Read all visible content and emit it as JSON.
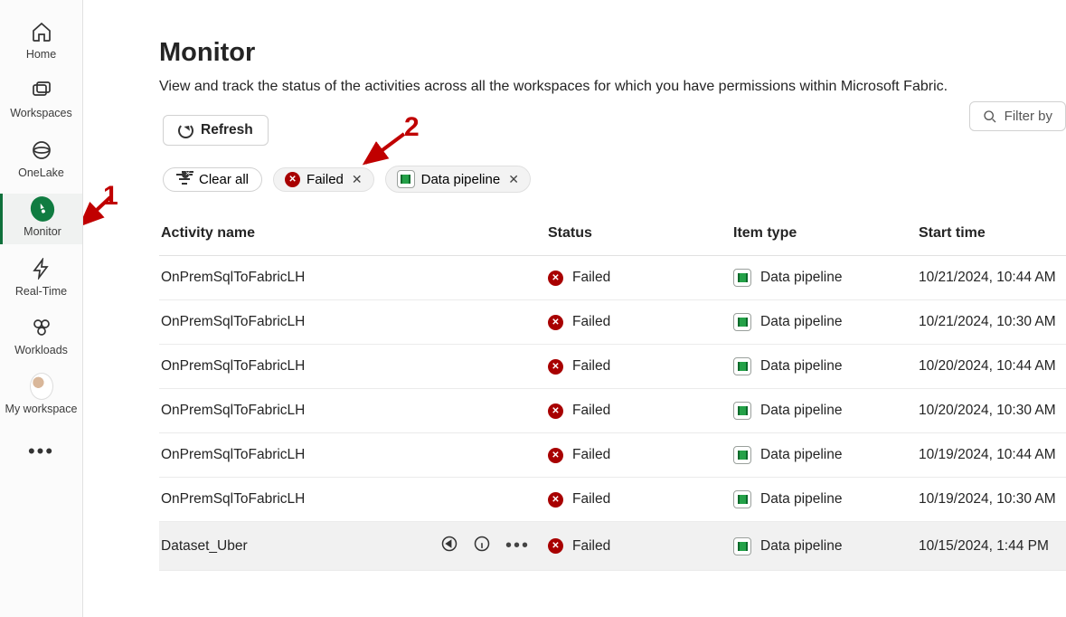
{
  "nav": {
    "items": [
      {
        "label": "Home",
        "icon": "home"
      },
      {
        "label": "Workspaces",
        "icon": "workspaces"
      },
      {
        "label": "OneLake",
        "icon": "onelake"
      },
      {
        "label": "Monitor",
        "icon": "monitor",
        "active": true
      },
      {
        "label": "Real-Time",
        "icon": "realtime"
      },
      {
        "label": "Workloads",
        "icon": "workloads"
      },
      {
        "label": "My workspace",
        "icon": "avatar"
      }
    ]
  },
  "page": {
    "title": "Monitor",
    "subtitle": "View and track the status of the activities across all the workspaces for which you have permissions within Microsoft Fabric."
  },
  "toolbar": {
    "refresh_label": "Refresh",
    "filter_label": "Filter by"
  },
  "filters": {
    "clear_all_label": "Clear all",
    "pills": [
      {
        "label": "Failed",
        "icon": "failed"
      },
      {
        "label": "Data pipeline",
        "icon": "pipeline"
      }
    ]
  },
  "table": {
    "headers": {
      "name": "Activity name",
      "status": "Status",
      "type": "Item type",
      "start": "Start time"
    },
    "rows": [
      {
        "name": "OnPremSqlToFabricLH",
        "status": "Failed",
        "type": "Data pipeline",
        "start": "10/21/2024, 10:44 AM"
      },
      {
        "name": "OnPremSqlToFabricLH",
        "status": "Failed",
        "type": "Data pipeline",
        "start": "10/21/2024, 10:30 AM"
      },
      {
        "name": "OnPremSqlToFabricLH",
        "status": "Failed",
        "type": "Data pipeline",
        "start": "10/20/2024, 10:44 AM"
      },
      {
        "name": "OnPremSqlToFabricLH",
        "status": "Failed",
        "type": "Data pipeline",
        "start": "10/20/2024, 10:30 AM"
      },
      {
        "name": "OnPremSqlToFabricLH",
        "status": "Failed",
        "type": "Data pipeline",
        "start": "10/19/2024, 10:44 AM"
      },
      {
        "name": "OnPremSqlToFabricLH",
        "status": "Failed",
        "type": "Data pipeline",
        "start": "10/19/2024, 10:30 AM"
      },
      {
        "name": "Dataset_Uber",
        "status": "Failed",
        "type": "Data pipeline",
        "start": "10/15/2024, 1:44 PM",
        "hovered": true
      }
    ]
  },
  "annotations": {
    "one": "1",
    "two": "2"
  }
}
